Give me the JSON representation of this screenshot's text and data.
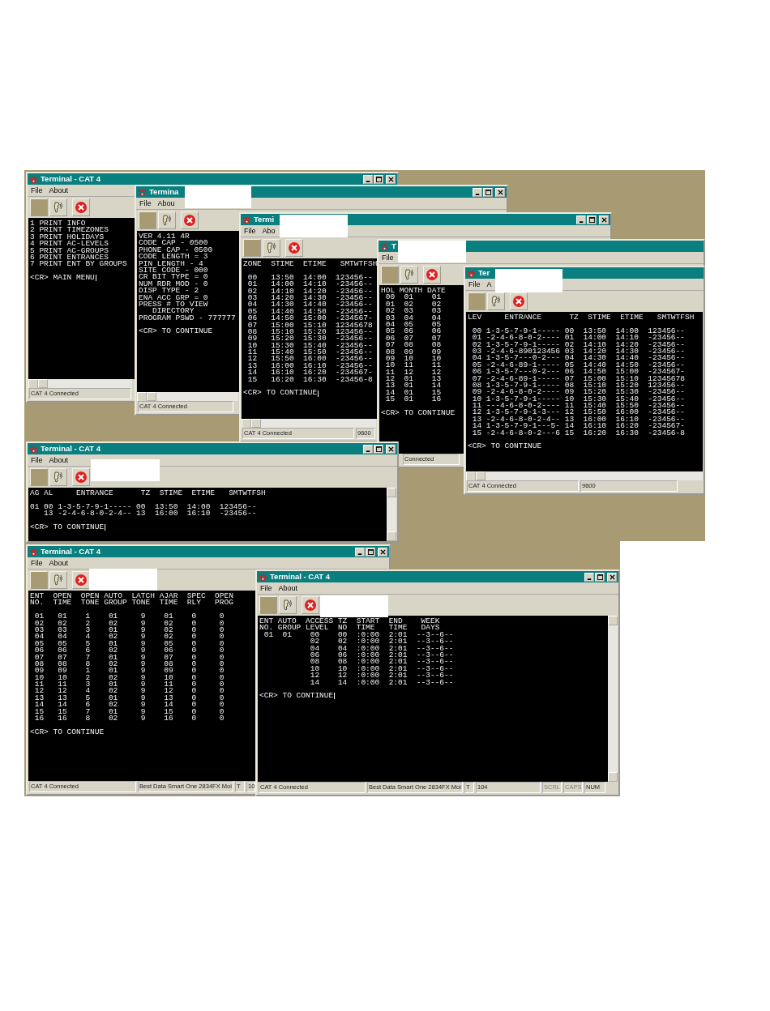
{
  "windows": [
    {
      "title": "Terminal - CAT 4",
      "menu": [
        "File",
        "About"
      ],
      "terminal": {
        "cursor": true,
        "blocks": [
          [
            "1 PRINT INFO",
            "2 PRINT TIMEZONES",
            "3 PRINT HOLIDAYS",
            "4 PRINT AC-LEVELS",
            "5 PRINT AC-GROUPS",
            "6 PRINT ENTRANCES",
            "7 PRINT ENT BY GROUPS"
          ],
          [
            "<CR> MAIN MENU"
          ]
        ]
      },
      "status": [
        {
          "text": "CAT 4 Connected",
          "disabled": false
        }
      ]
    },
    {
      "title": "Termina",
      "menu": [
        "File",
        "Abou"
      ],
      "terminal": {
        "cursor": false,
        "blocks": [
          [
            "VER 4.11 4R",
            "CODE CAP - 0500",
            "PHONE CAP - 0500",
            "CODE LENGTH = 3",
            "PIN LENGTH - 4",
            "SITE CODE - 000",
            "CR BIT TYPE = 0",
            "NUM RDR MOD - 0",
            "DISP TYPE - 2",
            "ENA ACC GRP = 0",
            "PRESS # TO VIEW",
            "   DIRECTORY",
            "PROGRAM PSWD - 777777"
          ],
          [
            "<CR> TO CONTINUE"
          ]
        ]
      },
      "status": [
        {
          "text": "CAT 4 Connected",
          "disabled": false
        }
      ]
    },
    {
      "title": "Termi",
      "menu": [
        "File",
        "Abo"
      ],
      "terminal": {
        "cursor": true,
        "blocks": [
          [
            "ZONE  STIME  ETIME   SMTWTFSH"
          ],
          [
            " 00   13:50  14:00  123456--",
            " 01   14:00  14:10  -23456--",
            " 02   14:10  14:20  -23456--",
            " 03   14:20  14:30  -23456--",
            " 04   14:30  14:40  -23456--",
            " 05   14:40  14:50  -23456--",
            " 06   14:50  15:00  -234567-",
            " 07   15:00  15:10  12345678",
            " 08   15:10  15:20  123456--",
            " 09   15:20  15:30  -23456--",
            " 10   15:30  15:40  -23456--",
            " 11   15:40  15:50  -23456--",
            " 12   15:50  16:00  -23456--",
            " 13   16:00  16:10  -23456--",
            " 14   16:10  16:20  -234567-",
            " 15   16:20  16:30  -23456-8"
          ],
          [
            "<CR> TO CONTINUE"
          ]
        ]
      },
      "status": [
        {
          "text": "CAT 4 Connected",
          "disabled": false
        },
        {
          "text": "9600",
          "disabled": false
        }
      ]
    },
    {
      "title": "T",
      "menu": [
        "File"
      ],
      "terminal": {
        "cursor": false,
        "blocks": [
          [
            "HOL MONTH DATE",
            " 00  01    01",
            " 01  02    02",
            " 02  03    03",
            " 03  04    04",
            " 04  05    05",
            " 05  06    06",
            " 06  07    07",
            " 07  08    08",
            " 08  09    09",
            " 09  10    10",
            " 10  11    11",
            " 11  12    12",
            " 12  01    13",
            " 13  01    14",
            " 14  01    15",
            " 15  01    16"
          ],
          [
            "<CR> TO CONTINUE"
          ]
        ]
      },
      "status": [
        {
          "text": "Connected",
          "disabled": false
        }
      ]
    },
    {
      "title": "Ter",
      "menu": [
        "File",
        "A"
      ],
      "terminal": {
        "cursor": false,
        "blocks": [
          [
            "LEV     ENTRANCE      TZ  STIME  ETIME   SMTWTFSH"
          ],
          [
            " 00 1-3-5-7-9-1----- 00  13:50  14:00  123456--",
            " 01 -2-4-6-8-0-2---- 01  14:00  14:10  -23456--",
            " 02 1-3-5-7-9-1----- 02  14:10  14:20  -23456--",
            " 03 -2-4-6-890123456 03  14:20  14:30  -23456--",
            " 04 1-3-5-7---0-2--- 04  14:30  14:40  -23456--",
            " 05 -2-4-6-89-1----- 05  14:40  14:50  -23456--",
            " 06 1-3-5-7---0-2--- 06  14:50  15:00  -234567-",
            " 07 -2-4-6-89-1----- 07  15:00  15:10  12345678",
            " 08 1-3-5-7-9-1----- 08  15:10  15:20  123456--",
            " 09 -2-4-6-8-0-2---- 09  15:20  15:30  -23456--",
            " 10 1-3-5-7-9-1----- 10  15:30  15:40  -23456--",
            " 11 ---4-6-8-0-2---- 11  15:40  15:50  -23456--",
            " 12 1-3-5-7-9-1-3--- 12  15:50  16:00  -23456--",
            " 13 -2-4-6-8-0-2-4-- 13  16:00  16:10  -23456--",
            " 14 1-3-5-7-9-1---5- 14  16:10  16:20  -234567-",
            " 15 -2-4-6-8-0-2---6 15  16:20  16:30  -23456-8"
          ],
          [
            "<CR> TO CONTINUE"
          ]
        ]
      },
      "status": [
        {
          "text": "CAT 4 Connected",
          "disabled": false
        },
        {
          "text": "9600",
          "disabled": false
        }
      ]
    },
    {
      "title": "Terminal - CAT 4",
      "menu": [
        "File",
        "About"
      ],
      "terminal": {
        "cursor": true,
        "blocks": [
          [
            "AG AL     ENTRANCE      TZ  STIME  ETIME   SMTWTFSH"
          ],
          [
            "01 00 1-3-5-7-9-1----- 00  13:50  14:00  123456--",
            "   13 -2-4-6-8-0-2-4-- 13  16:00  16:10  -23456--"
          ],
          [
            "<CR> TO CONTINUE"
          ]
        ]
      }
    },
    {
      "title": "Terminal - CAT 4",
      "menu": [
        "File",
        "About"
      ],
      "terminal": {
        "cursor": false,
        "blocks": [
          [
            "ENT  OPEN  OPEN AUTO  LATCH AJAR  SPEC  OPEN",
            "NO.  TIME  TONE GROUP TONE  TIME  RLY   PROG"
          ],
          [
            " 01   01    1    01     9    01    0     0",
            " 02   02    2    02     9    02    0     0",
            " 03   03    3    01     9    02    0     0",
            " 04   04    4    02     9    02    0     0",
            " 05   05    5    01     9    05    0     0",
            " 06   06    6    02     9    06    0     0",
            " 07   07    7    01     9    07    0     0",
            " 08   08    8    02     9    08    0     0",
            " 09   09    1    01     9    09    0     0",
            " 10   10    2    02     9    10    0     0",
            " 11   11    3    01     9    11    0     0",
            " 12   12    4    02     9    12    0     0",
            " 13   13    5    01     9    13    0     0",
            " 14   14    6    02     9    14    0     0",
            " 15   15    7    01     9    15    0     0",
            " 16   16    8    02     9    16    0     0"
          ],
          [
            "<CR> TO CONTINUE"
          ]
        ]
      },
      "status": [
        {
          "text": "CAT 4 Connected",
          "disabled": false
        },
        {
          "text": "Best Data Smart One 2834FX Moi",
          "disabled": false
        },
        {
          "text": "T",
          "disabled": false
        },
        {
          "text": "10",
          "disabled": false
        }
      ]
    },
    {
      "title": "Terminal - CAT 4",
      "menu": [
        "File",
        "About"
      ],
      "terminal": {
        "cursor": true,
        "blocks": [
          [
            "ENT AUTO  ACCESS TZ  START  END    WEEK",
            "NO. GROUP LEVEL  NO  TIME   TIME   DAYS",
            " 01  01    00    00  :0:00  2:01  --3--6--",
            "           02    02  :0:00  2:01  --3--6--",
            "           04    04  :0:00  2:01  --3--6--",
            "           06    06  :0:00  2:01  --3--6--",
            "           08    08  :0:00  2:01  --3--6--",
            "           10    10  :0:00  2:01  --3--6--",
            "           12    12  :0:00  2:01  --3--6--",
            "           14    14  :0:00  2:01  --3--6--"
          ],
          [
            "<CR> TO CONTINUE"
          ]
        ]
      },
      "status": [
        {
          "text": "CAT 4 Connected",
          "disabled": false
        },
        {
          "text": "Best Data Smart One 2834FX Moi",
          "disabled": false
        },
        {
          "text": "T",
          "disabled": false
        },
        {
          "text": "104",
          "disabled": false
        },
        {
          "text": "SCRL",
          "disabled": true
        },
        {
          "text": "CAPS",
          "disabled": true
        },
        {
          "text": "NUM",
          "disabled": false
        }
      ]
    }
  ]
}
